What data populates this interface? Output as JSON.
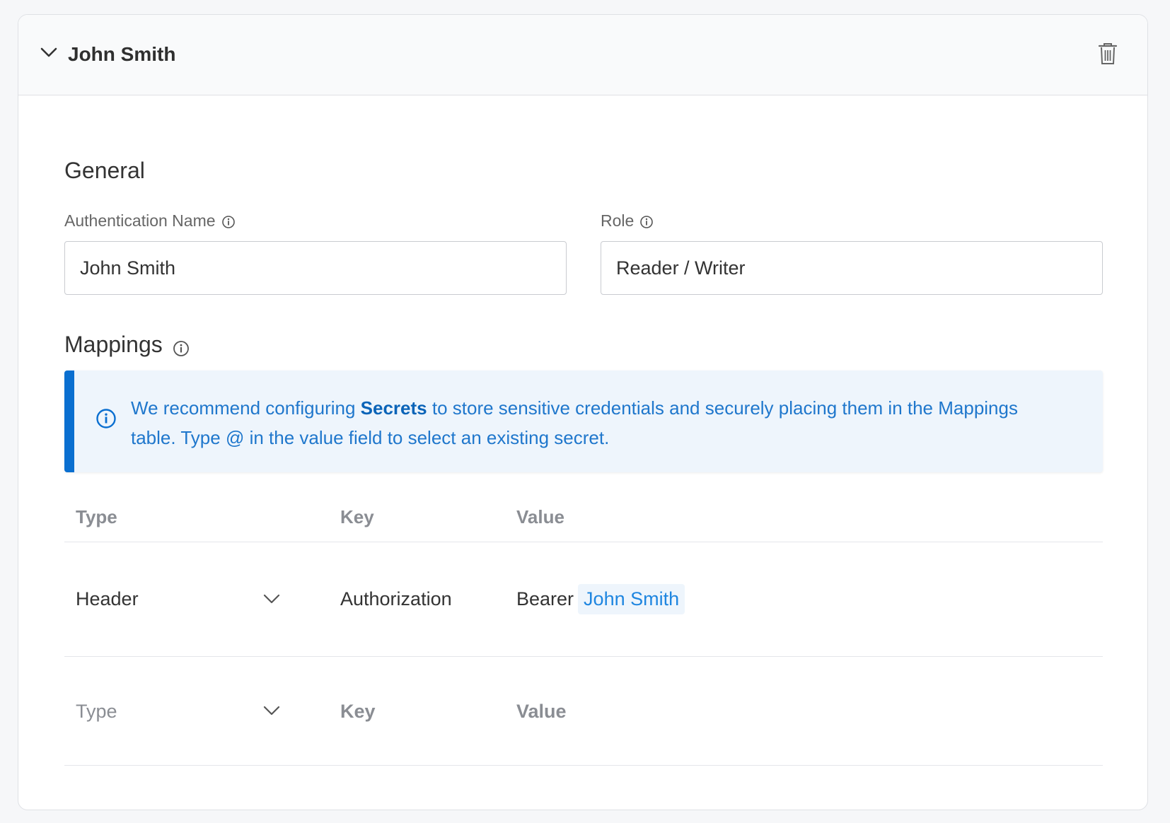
{
  "header": {
    "title": "John Smith",
    "collapse_icon": "chevron-down-icon",
    "delete_icon": "trash-icon"
  },
  "general": {
    "section_title": "General",
    "auth_name": {
      "label": "Authentication Name",
      "value": "John Smith"
    },
    "role": {
      "label": "Role",
      "value": "Reader / Writer"
    }
  },
  "mappings": {
    "section_title": "Mappings",
    "info": {
      "text_before": "We recommend configuring ",
      "bold": "Secrets",
      "text_after": " to store sensitive credentials and securely placing them in the Mappings table. Type @ in the value field to select an existing secret."
    },
    "columns": {
      "type": "Type",
      "key": "Key",
      "value": "Value"
    },
    "rows": [
      {
        "type": "Header",
        "key": "Authorization",
        "value_prefix": "Bearer",
        "value_secret": "John Smith"
      }
    ],
    "new_row": {
      "type_placeholder": "Type",
      "key_placeholder": "Key",
      "value_placeholder": "Value"
    }
  },
  "colors": {
    "accent": "#0a6fd0",
    "info_bg": "#eef5fc",
    "link": "#1f77cc"
  }
}
